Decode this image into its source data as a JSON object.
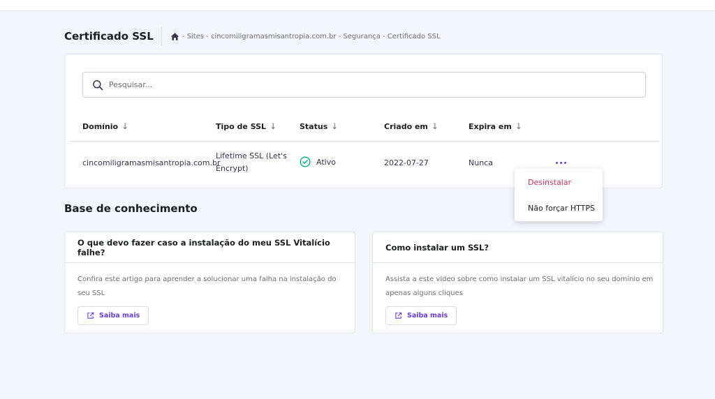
{
  "header": {
    "title": "Certificado SSL",
    "breadcrumb": "- Sites - cincomiligramasmisantropia.com.br - Segurança - Certificado SSL"
  },
  "search": {
    "placeholder": "Pesquisar..."
  },
  "table": {
    "columns": [
      "Domínio",
      "Tipo de SSL",
      "Status",
      "Criado em",
      "Expira em"
    ],
    "sort_icon": "↓",
    "rows": [
      {
        "domain": "cincomiligramasmisantropia.com.br",
        "ssl_type": "Lifetime SSL (Let's Encrypt)",
        "status": "Ativo",
        "created": "2022-07-27",
        "expires": "Nunca"
      }
    ]
  },
  "row_menu": {
    "items": [
      "Desinstalar",
      "Não forçar HTTPS"
    ]
  },
  "knowledge_base": {
    "title": "Base de conhecimento",
    "cards": [
      {
        "title": "O que devo fazer caso a instalação do meu SSL Vitalício falhe?",
        "text": "Confira este artigo para aprender a solucionar uma falha na instalação do seu SSL",
        "button": "Saiba mais"
      },
      {
        "title": "Como instalar um SSL?",
        "text": "Assista a este vídeo sobre como instalar um SSL vitalício no seu domínio em apenas alguns cliques",
        "button": "Saiba mais"
      }
    ]
  },
  "colors": {
    "accent": "#673de6",
    "danger": "#d63163",
    "success": "#00b090",
    "background": "#f4f4fb"
  },
  "icons": [
    "home-icon",
    "search-icon",
    "sort-arrow-icon",
    "check-circle-icon",
    "more-dots-icon",
    "external-link-icon"
  ]
}
